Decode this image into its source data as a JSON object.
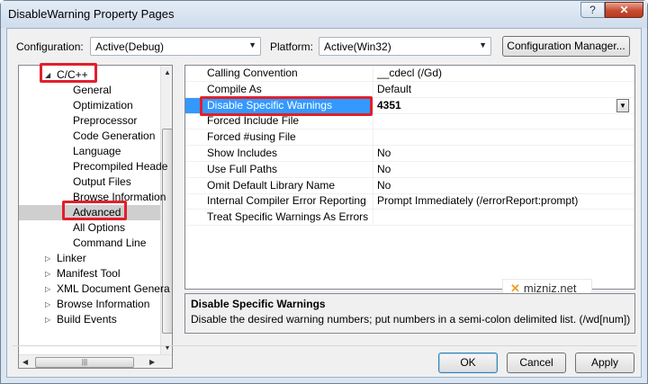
{
  "window": {
    "title": "DisableWarning Property Pages",
    "help_label": "?",
    "close_label": "✕"
  },
  "toolbar": {
    "configuration_label": "Configuration:",
    "configuration_value": "Active(Debug)",
    "platform_label": "Platform:",
    "platform_value": "Active(Win32)",
    "config_manager_label": "Configuration Manager..."
  },
  "tree": {
    "items": [
      {
        "label": "C/C++",
        "indent": 1,
        "expander": "◢"
      },
      {
        "label": "General",
        "indent": 2
      },
      {
        "label": "Optimization",
        "indent": 2
      },
      {
        "label": "Preprocessor",
        "indent": 2
      },
      {
        "label": "Code Generation",
        "indent": 2
      },
      {
        "label": "Language",
        "indent": 2
      },
      {
        "label": "Precompiled Heade",
        "indent": 2
      },
      {
        "label": "Output Files",
        "indent": 2
      },
      {
        "label": "Browse Information",
        "indent": 2
      },
      {
        "label": "Advanced",
        "indent": 2,
        "selected": true
      },
      {
        "label": "All Options",
        "indent": 2
      },
      {
        "label": "Command Line",
        "indent": 2
      },
      {
        "label": "Linker",
        "indent": 1,
        "expander": "▷"
      },
      {
        "label": "Manifest Tool",
        "indent": 1,
        "expander": "▷"
      },
      {
        "label": "XML Document Genera",
        "indent": 1,
        "expander": "▷"
      },
      {
        "label": "Browse Information",
        "indent": 1,
        "expander": "▷"
      },
      {
        "label": "Build Events",
        "indent": 1,
        "expander": "▷"
      }
    ]
  },
  "properties": [
    {
      "name": "Calling Convention",
      "value": "__cdecl (/Gd)"
    },
    {
      "name": "Compile As",
      "value": "Default"
    },
    {
      "name": "Disable Specific Warnings",
      "value": "4351",
      "selected": true
    },
    {
      "name": "Forced Include File",
      "value": ""
    },
    {
      "name": "Forced #using File",
      "value": ""
    },
    {
      "name": "Show Includes",
      "value": "No"
    },
    {
      "name": "Use Full Paths",
      "value": "No"
    },
    {
      "name": "Omit Default Library Name",
      "value": "No"
    },
    {
      "name": "Internal Compiler Error Reporting",
      "value": "Prompt Immediately (/errorReport:prompt)"
    },
    {
      "name": "Treat Specific Warnings As Errors",
      "value": ""
    }
  ],
  "description": {
    "title": "Disable Specific Warnings",
    "text": "Disable the desired warning numbers; put numbers in a semi-colon delimited list.     (/wd[num])"
  },
  "watermark": {
    "text": "mizniz.net"
  },
  "buttons": {
    "ok": "OK",
    "cancel": "Cancel",
    "apply": "Apply"
  },
  "colors": {
    "selection": "#3399ff",
    "highlight": "#e0202b"
  }
}
